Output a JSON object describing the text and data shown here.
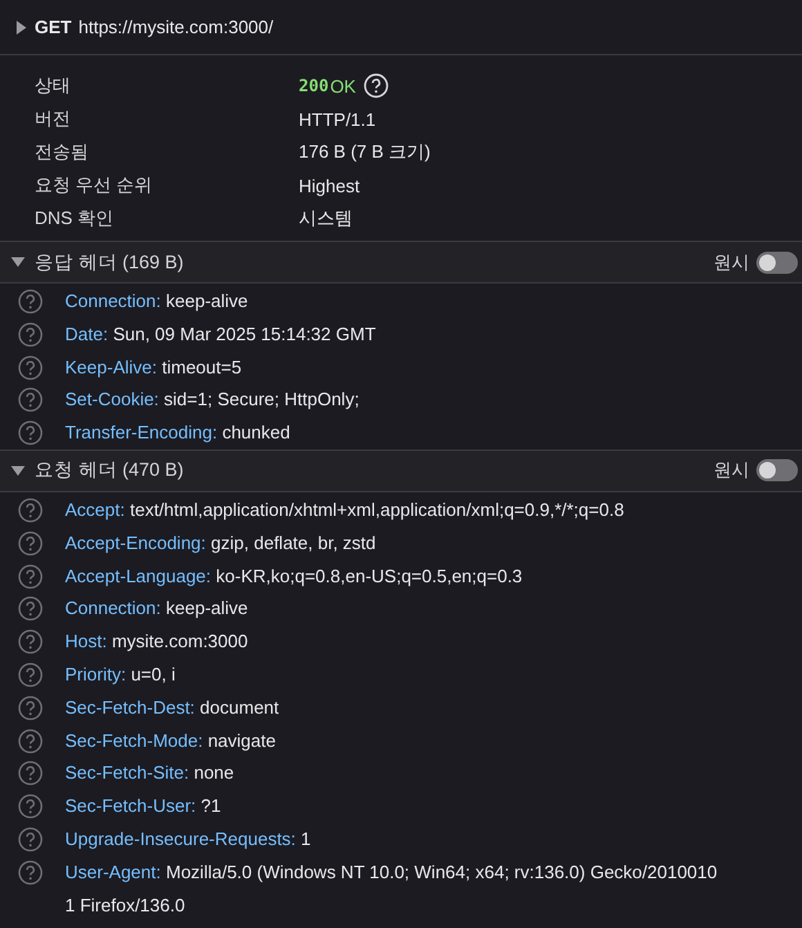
{
  "request": {
    "method": "GET",
    "url": "https://mysite.com:3000/"
  },
  "summary": [
    {
      "label": "상태",
      "kind": "status",
      "code": "200",
      "text": "OK"
    },
    {
      "label": "버전",
      "kind": "text",
      "value": "HTTP/1.1"
    },
    {
      "label": "전송됨",
      "kind": "text",
      "value": "176 B (7 B 크기)"
    },
    {
      "label": "요청 우선 순위",
      "kind": "text",
      "value": "Highest"
    },
    {
      "label": "DNS 확인",
      "kind": "text",
      "value": "시스템"
    }
  ],
  "sections": [
    {
      "title": "응답 헤더 (169 B)",
      "expanded": true,
      "raw_label": "원시",
      "raw": false,
      "headers": [
        {
          "name": "Connection:",
          "value": "keep-alive"
        },
        {
          "name": "Date:",
          "value": "Sun, 09 Mar 2025 15:14:32 GMT"
        },
        {
          "name": "Keep-Alive:",
          "value": "timeout=5"
        },
        {
          "name": "Set-Cookie:",
          "value": "sid=1; Secure; HttpOnly;"
        },
        {
          "name": "Transfer-Encoding:",
          "value": "chunked"
        }
      ]
    },
    {
      "title": "요청 헤더 (470 B)",
      "expanded": true,
      "raw_label": "원시",
      "raw": false,
      "headers": [
        {
          "name": "Accept:",
          "value": "text/html,application/xhtml+xml,application/xml;q=0.9,*/*;q=0.8"
        },
        {
          "name": "Accept-Encoding:",
          "value": "gzip, deflate, br, zstd"
        },
        {
          "name": "Accept-Language:",
          "value": "ko-KR,ko;q=0.8,en-US;q=0.5,en;q=0.3"
        },
        {
          "name": "Connection:",
          "value": "keep-alive"
        },
        {
          "name": "Host:",
          "value": "mysite.com:3000"
        },
        {
          "name": "Priority:",
          "value": "u=0, i"
        },
        {
          "name": "Sec-Fetch-Dest:",
          "value": "document"
        },
        {
          "name": "Sec-Fetch-Mode:",
          "value": "navigate"
        },
        {
          "name": "Sec-Fetch-Site:",
          "value": "none"
        },
        {
          "name": "Sec-Fetch-User:",
          "value": "?1"
        },
        {
          "name": "Upgrade-Insecure-Requests:",
          "value": "1"
        },
        {
          "name": "User-Agent:",
          "value": "Mozilla/5.0 (Windows NT 10.0; Win64; x64; rv:136.0) Gecko/20100101 Firefox/136.0"
        }
      ]
    }
  ]
}
